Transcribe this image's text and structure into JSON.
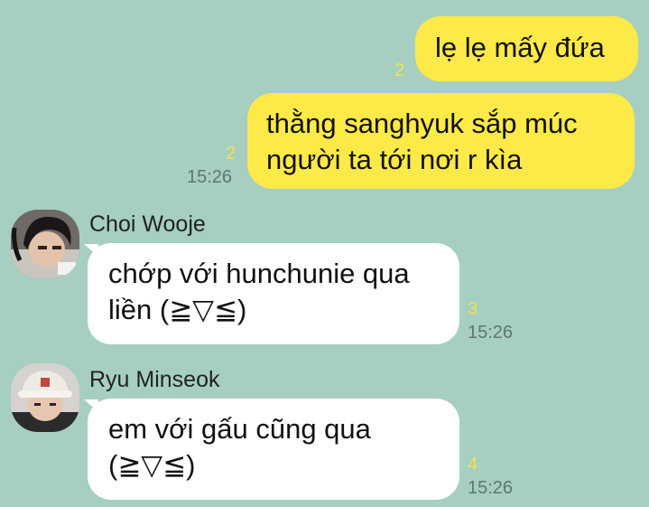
{
  "messages": [
    {
      "direction": "outgoing",
      "lines": [
        "lẹ lẹ mấy đứa"
      ],
      "unread_count": "2"
    },
    {
      "direction": "outgoing",
      "lines": [
        "thằng sanghyuk sắp múc",
        "người ta tới nơi r kìa"
      ],
      "unread_count": "2",
      "time": "15:26"
    },
    {
      "direction": "incoming",
      "sender": "Choi Wooje",
      "lines": [
        "chớp với hunchunie qua",
        "liền (≧▽≦)"
      ],
      "unread_count": "3",
      "time": "15:26"
    },
    {
      "direction": "incoming",
      "sender": "Ryu Minseok",
      "lines": [
        "em với gấu cũng qua",
        "(≧▽≦)"
      ],
      "unread_count": "4",
      "time": "15:26"
    }
  ],
  "colors": {
    "background": "#a6cfc1",
    "outgoing_bubble": "#fde947",
    "incoming_bubble": "#ffffff",
    "unread_count": "#f4e24a",
    "time": "#5e7770"
  }
}
